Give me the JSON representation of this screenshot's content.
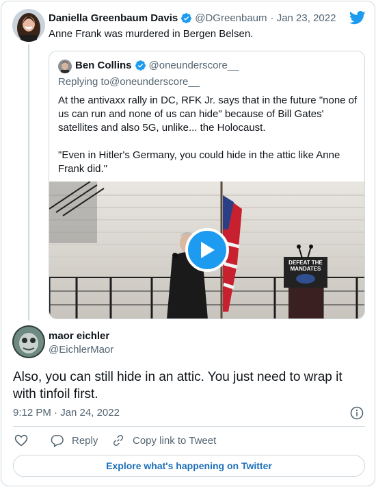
{
  "original_tweet": {
    "author_name": "Daniella Greenbaum Davis",
    "handle": "@DGreenbaum",
    "date": "· Jan 23, 2022",
    "text": "Anne Frank was murdered in Bergen Belsen."
  },
  "quoted_tweet": {
    "author_name": "Ben Collins",
    "handle": "@oneunderscore__",
    "replying_label": "Replying to ",
    "replying_handle": "@oneunderscore__",
    "text": "At the antivaxx rally in DC, RFK Jr. says that in the future \"none of us can run and none of us can hide\" because of Bill Gates' satellites and also 5G, unlike... the Holocaust.\n\n\"Even in Hitler's Germany, you could hide in the attic like Anne Frank did.\"",
    "video_sign": {
      "line1": "DEFEAT THE",
      "line2": "MANDATES"
    }
  },
  "reply_tweet": {
    "author_name": "maor eichler",
    "handle": "@EichlerMaor",
    "text": "Also, you can still hide in an attic. You just need to wrap it with tinfoil first.",
    "timestamp": "9:12 PM · Jan 24, 2022"
  },
  "actions": {
    "reply_label": "Reply",
    "copy_link_label": "Copy link to Tweet"
  },
  "explore_label": "Explore what's happening on Twitter",
  "colors": {
    "twitter_blue": "#1d9bf0",
    "text": "#0f1419",
    "muted": "#536471",
    "border": "#cfd9de"
  },
  "icons": [
    "twitter-bird-icon",
    "verified-badge-icon",
    "play-icon",
    "info-icon",
    "heart-icon",
    "reply-icon",
    "link-icon"
  ]
}
